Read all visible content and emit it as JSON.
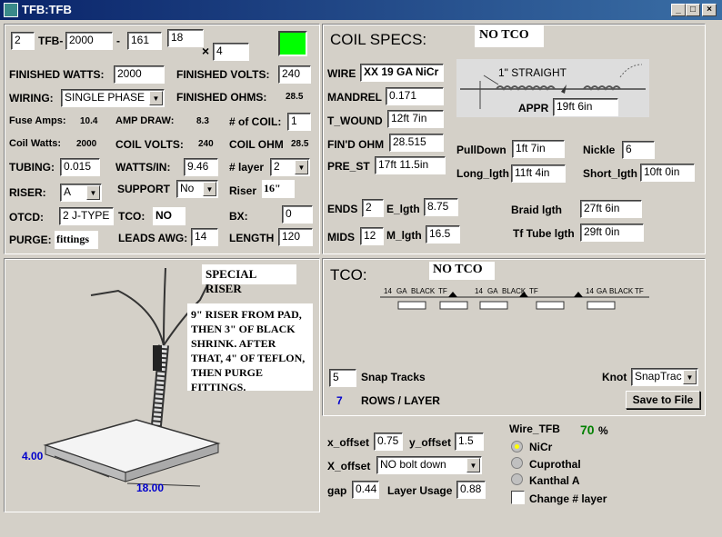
{
  "window": {
    "title": "TFB:TFB",
    "min": "_",
    "max": "□",
    "close": "×"
  },
  "top": {
    "qty": "2",
    "tfb_label": "TFB-",
    "length": "2000",
    "dash": "-",
    "width": "161",
    "height": "18",
    "times": "×",
    "multiplier": "4"
  },
  "left": {
    "finished_watts_label": "FINISHED WATTS:",
    "finished_watts": "2000",
    "finished_volts_label": "FINISHED VOLTS:",
    "finished_volts": "240",
    "wiring_label": "WIRING:",
    "wiring": "SINGLE PHASE",
    "finished_ohms_label": "FINISHED OHMS:",
    "finished_ohms": "28.5",
    "fuse_amps_label": "Fuse Amps:",
    "fuse_amps": "10.4",
    "amp_draw_label": "AMP DRAW:",
    "amp_draw": "8.3",
    "num_coil_label": "# of COIL:",
    "num_coil": "1",
    "coil_watts_label": "Coil Watts:",
    "coil_watts": "2000",
    "coil_volts_label": "COIL VOLTS:",
    "coil_volts": "240",
    "coil_ohm_label": "COIL OHM",
    "coil_ohm": "28.5",
    "tubing_label": "TUBING:",
    "tubing": "0.015",
    "watts_in_label": "WATTS/IN:",
    "watts_in": "9.46",
    "layer_label": "# layer",
    "layer": "2",
    "riser_label": "RISER:",
    "riser": "A",
    "support_label": "SUPPORT",
    "support": "No",
    "riser2_label": "Riser",
    "riser2": "16\"",
    "otcd_label": "OTCD:",
    "otcd": "2 J-TYPE",
    "tco_label": "TCO:",
    "tco": "NO",
    "bx_label": "BX:",
    "bx": "0",
    "purge_label": "PURGE:",
    "purge": "fittings",
    "leads_awg_label": "LEADS AWG:",
    "leads_awg": "14",
    "length_label": "LENGTH",
    "length": "120"
  },
  "coil": {
    "title": "COIL SPECS:",
    "tco_note": "NO TCO",
    "wire_label": "WIRE",
    "wire": "XX 19 GA NiCr",
    "mandrel_label": "MANDREL",
    "mandrel": "0.171",
    "t_wound_label": "T_WOUND",
    "t_wound": "12ft 7in",
    "find_ohm_label": "FIN'D OHM",
    "find_ohm": "28.515",
    "pre_st_label": "PRE_ST",
    "pre_st": "17ft 11.5in",
    "straight_label": "1\" STRAIGHT",
    "appr_label": "APPR",
    "appr": "19ft 6in",
    "pulldown_label": "PullDown",
    "pulldown": "1ft 7in",
    "nickle_label": "Nickle",
    "nickle": "6",
    "long_lgth_label": "Long_lgth",
    "long_lgth": "11ft 4in",
    "short_lgth_label": "Short_lgth",
    "short_lgth": "10ft 0in",
    "ends_label": "ENDS",
    "ends": "2",
    "e_lgth_label": "E_lgth",
    "e_lgth": "8.75",
    "braid_label": "Braid lgth",
    "braid": "27ft 6in",
    "mids_label": "MIDS",
    "mids": "12",
    "m_lgth_label": "M_lgth",
    "m_lgth": "16.5",
    "tf_tube_label": "Tf Tube lgth",
    "tf_tube": "29ft 0in"
  },
  "special": {
    "title": "SPECIAL RISER",
    "note": "9\" RISER FROM PAD, THEN 3\" OF BLACK SHRINK. AFTER THAT, 4\" OF TEFLON, THEN PURGE FITTINGS.",
    "dim1": "4.00",
    "dim2": "18.00"
  },
  "tco": {
    "title": "TCO:",
    "note": "NO TCO",
    "wire_labels": [
      "14",
      "GA",
      "BLACK",
      "TF",
      "14",
      "GA",
      "BLACK",
      "TF",
      "14",
      "GA",
      "BLACK",
      "TF"
    ],
    "snap_tracks_label": "Snap Tracks",
    "snap_tracks": "5",
    "rows_value": "7",
    "rows_label": "ROWS / LAYER",
    "knot_label": "Knot",
    "knot": "SnapTrac",
    "save_label": "Save to File"
  },
  "offsets": {
    "x_offset_label": "x_offset",
    "x_offset": "0.75",
    "y_offset_label": "y_offset",
    "y_offset": "1.5",
    "X_offset_label": "X_offset",
    "X_offset": "NO bolt down",
    "gap_label": "gap",
    "gap": "0.44",
    "layer_usage_label": "Layer Usage",
    "layer_usage": "0.88",
    "wire_tfb_label": "Wire_TFB",
    "wire_tfb_pct": "70",
    "pct_sign": "%",
    "radio_nicr": "NiCr",
    "radio_cuprothal": "Cuprothal",
    "radio_kanthal": "Kanthal A",
    "change_layer": "Change # layer"
  },
  "colors": {
    "accent_green": "#00ff00",
    "blue_value": "#0000cc",
    "green_value": "#008000"
  }
}
